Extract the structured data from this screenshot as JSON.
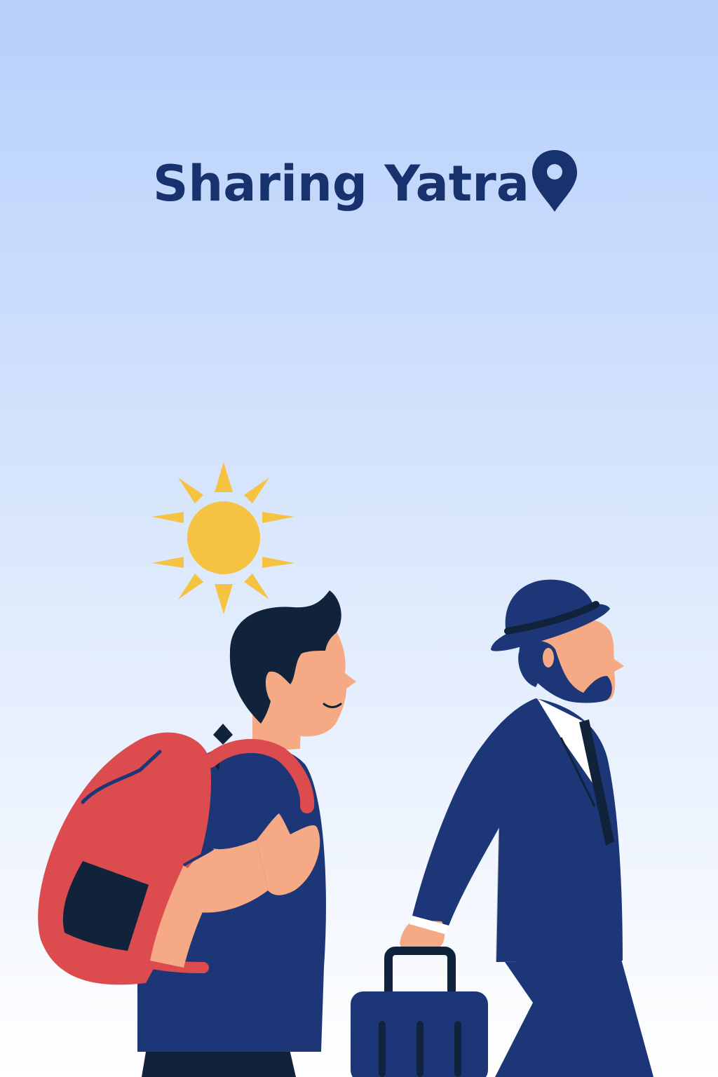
{
  "app": {
    "title": "Sharing Yatra",
    "brand_color": "#18326d"
  },
  "icons": {
    "location": "location-pin-icon",
    "sun": "sun-icon"
  },
  "illustration": {
    "left_figure": "backpacker",
    "right_figure": "businessman-with-suitcase",
    "colors": {
      "navy": "#1d3678",
      "dark": "#10233a",
      "skin": "#f5aa85",
      "backpack": "#dc4b4e",
      "sun": "#f5c242"
    }
  }
}
